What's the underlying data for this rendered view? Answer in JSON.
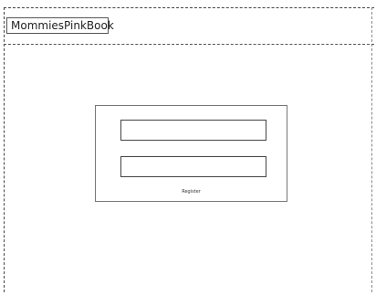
{
  "header": {
    "brand": "MommiesPinkBook"
  },
  "login": {
    "field_1": {
      "value": "",
      "placeholder": ""
    },
    "field_2": {
      "value": "",
      "placeholder": ""
    },
    "register_link": "Register"
  }
}
